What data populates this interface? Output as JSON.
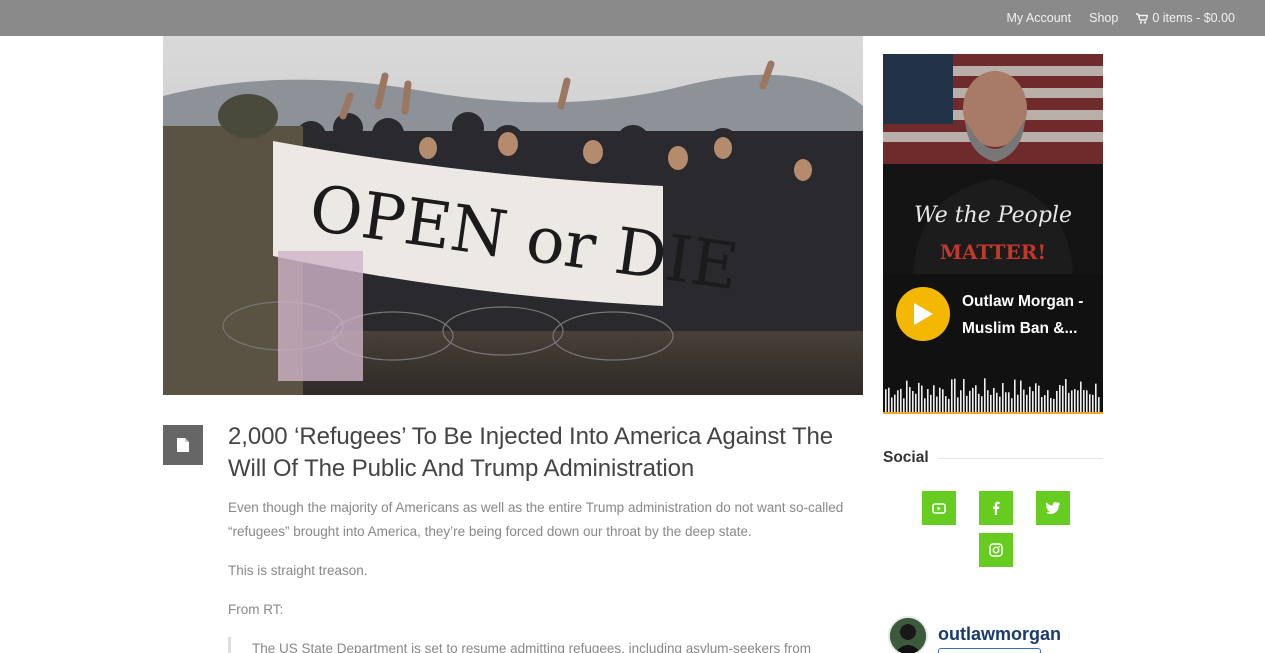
{
  "topbar": {
    "my_account": "My Account",
    "shop": "Shop",
    "cart": "0 items - $0.00",
    "background": "#8a8a8a"
  },
  "post": {
    "format_icon": "document-icon",
    "title": "2,000 ‘Refugees’ To Be Injected Into America Against The Will Of The Public And Trump Administration",
    "paragraphs": [
      "Even though the majority of Americans as well as the entire Trump administration do not want so-called “refugees” brought into America, they’re being forced down our throat by the deep state.",
      "This is straight treason.",
      "From RT:"
    ],
    "quote": "The US State Department is set to resume admitting refugees, including asylum-seekers from"
  },
  "featured_image": {
    "banner_text": "OPEN or DIE"
  },
  "player": {
    "art_text_line1": "We the People",
    "art_text_line2": "MATTER!",
    "track_title": "Outlaw Morgan - Muslim Ban &...",
    "accent": "#f5b800"
  },
  "sidebar": {
    "social_title": "Social",
    "social_color": "#66cc1f",
    "social_icons": [
      "youtube-icon",
      "facebook-icon",
      "twitter-icon",
      "instagram-icon"
    ]
  },
  "instagram": {
    "handle": "outlawmorgan"
  }
}
